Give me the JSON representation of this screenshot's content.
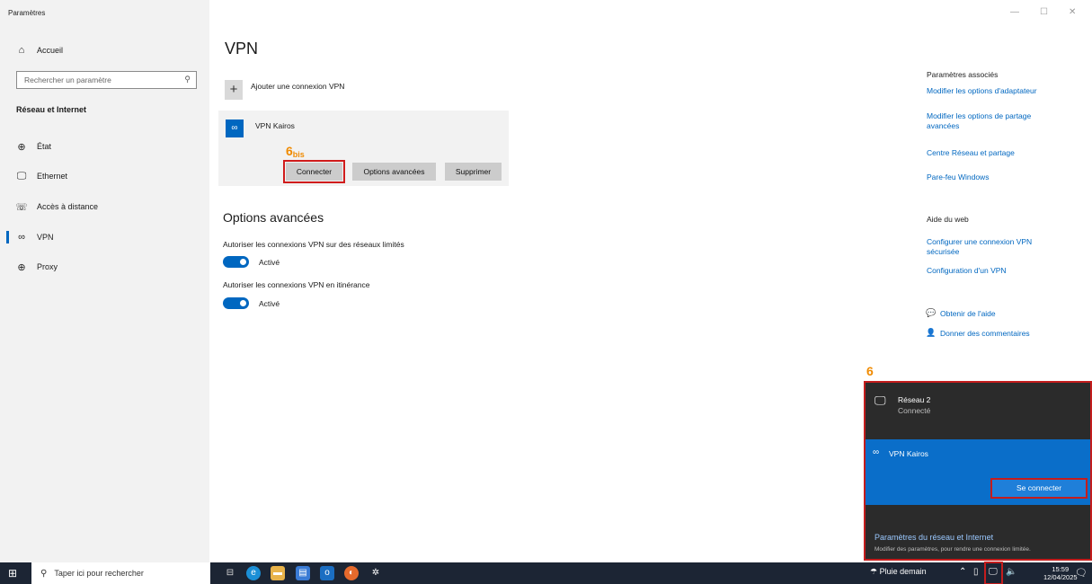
{
  "window": {
    "title": "Paramètres",
    "minimize_icon": "—",
    "maximize_icon": "☐",
    "close_icon": "✕"
  },
  "sidebar": {
    "home_label": "Accueil",
    "search_placeholder": "Rechercher un paramètre",
    "section_heading": "Réseau et Internet",
    "items": [
      {
        "label": "État",
        "icon": "status-icon"
      },
      {
        "label": "Ethernet",
        "icon": "ethernet-icon"
      },
      {
        "label": "Accès à distance",
        "icon": "dialup-icon"
      },
      {
        "label": "VPN",
        "icon": "vpn-icon",
        "active": true
      },
      {
        "label": "Proxy",
        "icon": "proxy-icon"
      }
    ]
  },
  "main": {
    "title": "VPN",
    "add_connection_label": "Ajouter une connexion VPN",
    "vpn_name": "VPN Kairos",
    "step_label": "6",
    "step_suffix": "bis",
    "buttons": {
      "connect": "Connecter",
      "advanced": "Options avancées",
      "remove": "Supprimer"
    },
    "advanced_title": "Options avancées",
    "option1_text": "Autoriser les connexions VPN sur des réseaux limités",
    "option1_state": "Activé",
    "option2_text": "Autoriser les connexions VPN en itinérance",
    "option2_state": "Activé"
  },
  "related": {
    "heading": "Paramètres associés",
    "links": [
      "Modifier les options d'adaptateur",
      "Modifier les options de partage avancées",
      "Centre Réseau et partage",
      "Pare-feu Windows"
    ],
    "web_heading": "Aide du web",
    "web_links": [
      "Configurer une connexion VPN sécurisée",
      "Configuration d'un VPN"
    ],
    "help_label": "Obtenir de l'aide",
    "feedback_label": "Donner des commentaires"
  },
  "flyout": {
    "step_label": "6",
    "network_name": "Réseau 2",
    "network_status": "Connecté",
    "vpn_name": "VPN Kairos",
    "connect_button": "Se connecter",
    "settings_link": "Paramètres du réseau et Internet",
    "settings_sub": "Modifier des paramètres, pour rendre une connexion limitée."
  },
  "taskbar": {
    "search_placeholder": "Taper ici pour rechercher",
    "weather": "Pluie demain",
    "time": "15:59",
    "date": "12/04/2025"
  },
  "colors": {
    "accent": "#0067c0",
    "annotation": "#c41d1d",
    "step": "#f08a00"
  }
}
